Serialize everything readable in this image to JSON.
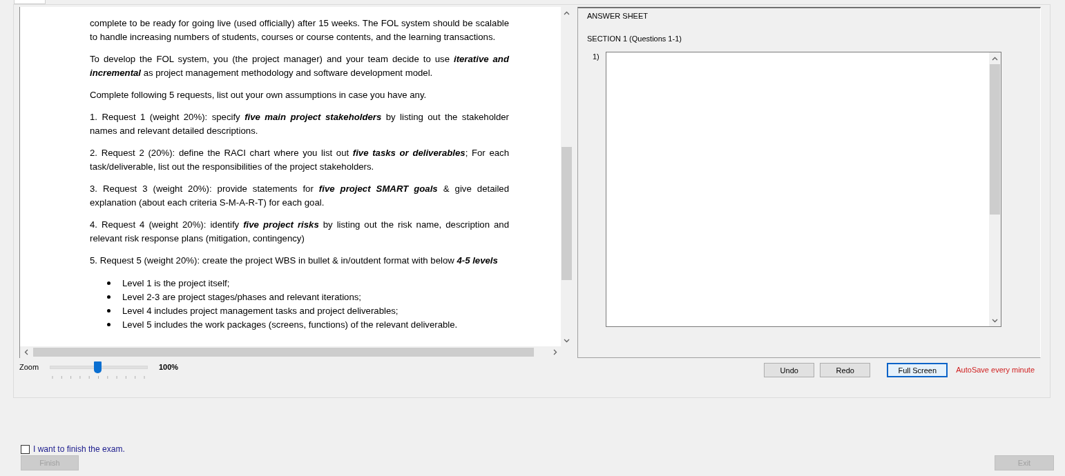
{
  "document": {
    "paragraphs": [
      {
        "text": "complete to be ready for going live (used officially) after 15 weeks. The FOL system should be scalable to handle increasing numbers of students, courses or course contents, and the learning transactions."
      },
      {
        "text": "To develop the FOL system, you (the project manager) and your team decide to use **iterative and incremental** as project management methodology and software development model."
      },
      {
        "text": "Complete following 5 requests, list out your own assumptions in case you have any."
      },
      {
        "text": "1. Request 1 (weight 20%): specify **five main project stakeholders** by listing out the stakeholder names and relevant detailed descriptions."
      },
      {
        "text": "2. Request 2 (20%): define the RACI chart where you list out **five tasks or deliverables**; For each task/deliverable, list out the responsibilities of the project stakeholders."
      },
      {
        "text": "3. Request 3 (weight 20%): provide statements for **five project SMART goals** & give detailed explanation (about each criteria S-M-A-R-T) for each goal."
      },
      {
        "text": "4. Request 4 (weight 20%): identify **five project risks** by listing out the risk name, description and relevant risk response plans (mitigation, contingency)"
      },
      {
        "text": "5. Request 5 (weight 20%): create the project WBS in bullet & in/outdent format with below **4-5 levels**"
      }
    ],
    "bullets": [
      "Level 1 is the project itself;",
      "Level 2-3 are project stages/phases and relevant iterations;",
      "Level 4 includes project management tasks and project deliverables;",
      "Level 5 includes the work packages (screens, functions) of the relevant deliverable."
    ]
  },
  "zoom": {
    "label": "Zoom",
    "level": 0.5,
    "reading": "100%"
  },
  "answer_sheet": {
    "title": "ANSWER SHEET",
    "section": "SECTION 1 (Questions 1-1)",
    "questions": [
      {
        "number": "1)"
      }
    ]
  },
  "buttons": [
    {
      "label": "Undo",
      "focused": false
    },
    {
      "label": "Redo",
      "focused": false
    },
    {
      "label": "Full Screen",
      "focused": true
    }
  ],
  "autosave_note": "AutoSave every minute",
  "finish_checkbox": {
    "label": "I want to finish the exam.",
    "checked": false
  },
  "finish_button": {
    "label": "Finish",
    "disabled": true
  },
  "exit_button": {
    "label": "Exit",
    "disabled": true
  }
}
